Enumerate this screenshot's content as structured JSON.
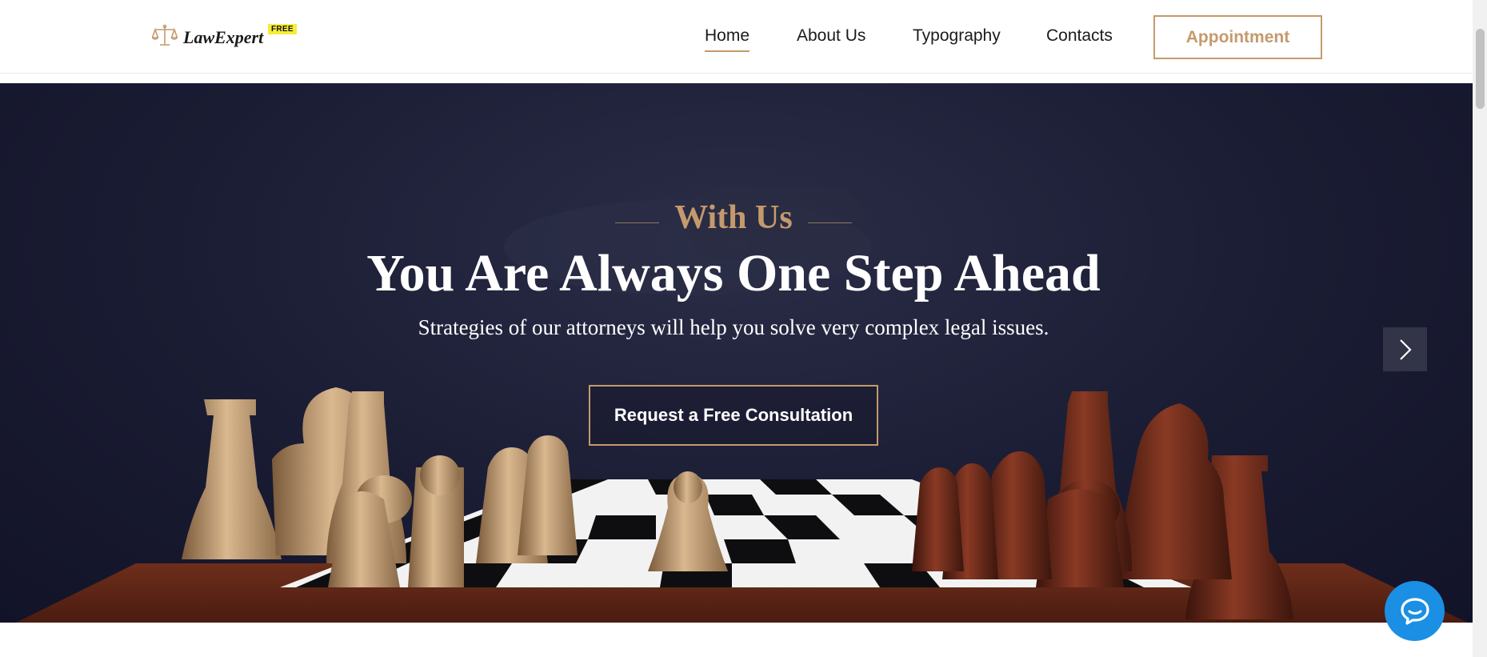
{
  "header": {
    "logo_text": "LawExpert",
    "logo_badge": "FREE",
    "nav": [
      {
        "label": "Home",
        "active": true
      },
      {
        "label": "About Us",
        "active": false
      },
      {
        "label": "Typography",
        "active": false
      },
      {
        "label": "Contacts",
        "active": false
      }
    ],
    "cta_label": "Appointment"
  },
  "hero": {
    "eyebrow": "With Us",
    "headline": "You Are Always One Step Ahead",
    "subline": "Strategies of our attorneys will help you solve very complex legal issues.",
    "button_label": "Request a Free Consultation"
  },
  "icons": {
    "logo": "scales-icon",
    "slider_next": "chevron-right-icon",
    "chat": "chat-bubble-icon"
  },
  "colors": {
    "accent": "#c49a6c",
    "hero_bg": "#1a1c33",
    "chat": "#1a8fe3",
    "badge": "#f7ec3b"
  }
}
